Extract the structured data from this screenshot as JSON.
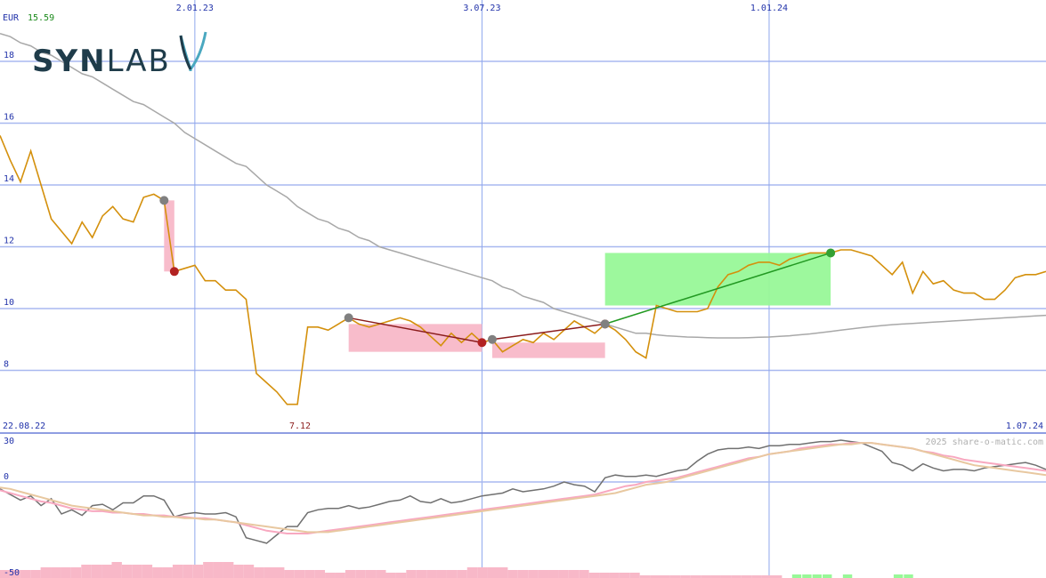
{
  "logo": {
    "bold": "SYN",
    "light": "LAB"
  },
  "header": {
    "currency": "EUR",
    "last_price": "15.59"
  },
  "watermark": "2025 share-o-matic.com",
  "colors": {
    "price": "#d4900c",
    "sma": "#a8a8a8",
    "grid": "#a8b8f0",
    "vgrid": "#8ea7ec",
    "gain_fill": "#98f898",
    "loss_fill": "#f8b8c8",
    "gain_line": "#229922",
    "loss_line": "#8b1c1c",
    "marker_grey": "#808080",
    "marker_red": "#b22222",
    "marker_green": "#33a033",
    "osc_dark": "#707070",
    "osc_pink": "#f8a8c0",
    "osc_tan": "#e8c8a0",
    "logo": "#1f3c4a",
    "logo_accent": "#4aa8c0"
  },
  "chart_data": [
    {
      "type": "line",
      "title": "",
      "x_top_labels": [
        "2.01.23",
        "3.07.23",
        "1.01.24"
      ],
      "x_bottom_labels": [
        "22.08.22",
        "7.12",
        "1.07.24"
      ],
      "y_ticks": [
        "8",
        "10",
        "12",
        "14",
        "16",
        "18"
      ],
      "ylim": [
        6,
        19
      ],
      "grid": true,
      "series": [
        {
          "key": "price",
          "values": [
            15.6,
            14.8,
            14.1,
            15.1,
            14.0,
            12.9,
            12.5,
            12.1,
            12.8,
            12.3,
            13.0,
            13.3,
            12.9,
            12.8,
            13.6,
            13.7,
            13.5,
            11.2,
            11.3,
            11.4,
            10.9,
            10.9,
            10.6,
            10.6,
            10.3,
            7.9,
            7.6,
            7.3,
            6.9,
            6.9,
            9.4,
            9.4,
            9.3,
            9.5,
            9.7,
            9.5,
            9.4,
            9.5,
            9.6,
            9.7,
            9.6,
            9.4,
            9.1,
            8.8,
            9.2,
            8.9,
            9.2,
            8.9,
            9.0,
            8.6,
            8.8,
            9.0,
            8.9,
            9.2,
            9.0,
            9.3,
            9.6,
            9.4,
            9.2,
            9.5,
            9.3,
            9.0,
            8.6,
            8.4,
            10.1,
            10.0,
            9.9,
            9.9,
            9.9,
            10.0,
            10.7,
            11.1,
            11.2,
            11.4,
            11.5,
            11.5,
            11.4,
            11.6,
            11.7,
            11.8,
            11.8,
            11.8,
            11.9,
            11.9,
            11.8,
            11.7,
            11.4,
            11.1,
            11.5,
            10.5,
            11.2,
            10.8,
            10.9,
            10.6,
            10.5,
            10.5,
            10.3,
            10.3,
            10.6,
            11.0,
            11.1,
            11.1,
            11.2
          ]
        },
        {
          "key": "sma",
          "values": [
            18.9,
            18.8,
            18.6,
            18.5,
            18.3,
            18.2,
            18.0,
            17.8,
            17.6,
            17.5,
            17.3,
            17.1,
            16.9,
            16.7,
            16.6,
            16.4,
            16.2,
            16.0,
            15.7,
            15.5,
            15.3,
            15.1,
            14.9,
            14.7,
            14.6,
            14.3,
            14.0,
            13.8,
            13.6,
            13.3,
            13.1,
            12.9,
            12.8,
            12.6,
            12.5,
            12.3,
            12.2,
            12.0,
            11.9,
            11.8,
            11.7,
            11.6,
            11.5,
            11.4,
            11.3,
            11.2,
            11.1,
            11.0,
            10.9,
            10.7,
            10.6,
            10.4,
            10.3,
            10.2,
            10.0,
            9.9,
            9.8,
            9.7,
            9.6,
            9.5,
            9.4,
            9.3,
            9.2,
            9.2,
            9.15,
            9.12,
            9.1,
            9.08,
            9.07,
            9.06,
            9.05,
            9.05,
            9.05,
            9.06,
            9.07,
            9.08,
            9.1,
            9.12,
            9.15,
            9.18,
            9.22,
            9.26,
            9.3,
            9.34,
            9.38,
            9.42,
            9.45,
            9.48,
            9.5,
            9.52,
            9.54,
            9.56,
            9.58,
            9.6,
            9.62,
            9.64,
            9.66,
            9.68,
            9.7,
            9.72,
            9.74,
            9.76,
            9.78
          ]
        }
      ],
      "annotations": [
        {
          "kind": "loss",
          "from_index": 16,
          "to_index": 17,
          "fill_top": 13.5,
          "fill_bottom": 11.2
        },
        {
          "kind": "loss",
          "from_index": 34,
          "to_index": 47,
          "fill_top": 9.5,
          "fill_bottom": 8.6
        },
        {
          "kind": "loss",
          "from_index": 48,
          "to_index": 59,
          "fill_top": 8.9,
          "fill_bottom": 8.4
        },
        {
          "kind": "gain",
          "from_index": 59,
          "to_index": 81,
          "fill_top": 11.8,
          "fill_bottom": 10.1
        }
      ]
    },
    {
      "type": "line",
      "title": "",
      "y_ticks": [
        "30",
        "0",
        "-50"
      ],
      "ylim": [
        -50,
        32
      ],
      "series": [
        {
          "key": "osc_dark",
          "values": [
            -5,
            -9,
            -13,
            -10,
            -17,
            -12,
            -23,
            -20,
            -24,
            -17,
            -16,
            -20,
            -15,
            -15,
            -10,
            -10,
            -13,
            -25,
            -23,
            -22,
            -23,
            -23,
            -22,
            -25,
            -40,
            -42,
            -44,
            -38,
            -32,
            -32,
            -22,
            -20,
            -19,
            -19,
            -17,
            -19,
            -18,
            -16,
            -14,
            -13,
            -10,
            -14,
            -15,
            -12,
            -15,
            -14,
            -12,
            -10,
            -9,
            -8,
            -5,
            -7,
            -6,
            -5,
            -3,
            0,
            -2,
            -3,
            -7,
            3,
            5,
            4,
            4,
            5,
            4,
            6,
            8,
            9,
            15,
            20,
            23,
            24,
            24,
            25,
            24,
            26,
            26,
            27,
            27,
            28,
            29,
            29,
            30,
            29,
            28,
            25,
            22,
            14,
            12,
            8,
            13,
            10,
            8,
            9,
            9,
            8,
            10,
            11,
            12,
            13,
            14,
            12,
            9
          ]
        },
        {
          "key": "osc_pink",
          "values": [
            -6,
            -8,
            -10,
            -12,
            -14,
            -15,
            -17,
            -19,
            -20,
            -21,
            -21,
            -22,
            -22,
            -23,
            -23,
            -24,
            -24,
            -25,
            -25,
            -26,
            -26,
            -27,
            -28,
            -29,
            -31,
            -33,
            -35,
            -36,
            -37,
            -37,
            -37,
            -36,
            -35,
            -34,
            -33,
            -32,
            -31,
            -30,
            -29,
            -28,
            -27,
            -26,
            -25,
            -24,
            -23,
            -22,
            -21,
            -20,
            -19,
            -18,
            -17,
            -16,
            -15,
            -14,
            -13,
            -12,
            -11,
            -10,
            -9,
            -7,
            -5,
            -3,
            -2,
            0,
            1,
            2,
            3,
            5,
            7,
            9,
            11,
            13,
            15,
            17,
            18,
            20,
            21,
            22,
            24,
            25,
            26,
            27,
            27,
            28,
            28,
            28,
            27,
            26,
            25,
            24,
            22,
            21,
            19,
            18,
            16,
            15,
            14,
            13,
            12,
            11,
            10,
            9,
            8
          ]
        },
        {
          "key": "osc_tan",
          "values": [
            -4,
            -5,
            -7,
            -9,
            -11,
            -13,
            -15,
            -17,
            -18,
            -19,
            -20,
            -21,
            -22,
            -23,
            -24,
            -24,
            -25,
            -25,
            -26,
            -26,
            -27,
            -27,
            -28,
            -29,
            -30,
            -31,
            -32,
            -33,
            -34,
            -35,
            -36,
            -36,
            -36,
            -35,
            -34,
            -33,
            -32,
            -31,
            -30,
            -29,
            -28,
            -27,
            -26,
            -25,
            -24,
            -23,
            -22,
            -21,
            -20,
            -19,
            -18,
            -17,
            -16,
            -15,
            -14,
            -13,
            -12,
            -11,
            -10,
            -9,
            -8,
            -6,
            -4,
            -2,
            -1,
            0,
            2,
            4,
            6,
            8,
            10,
            12,
            14,
            16,
            18,
            20,
            21,
            22,
            23,
            24,
            25,
            26,
            27,
            27,
            28,
            28,
            27,
            26,
            25,
            24,
            22,
            20,
            18,
            16,
            14,
            12,
            11,
            10,
            9,
            8,
            7,
            6,
            5
          ]
        }
      ],
      "volume_bars": [
        3,
        3,
        3,
        3,
        4,
        4,
        4,
        4,
        5,
        5,
        5,
        6,
        5,
        5,
        5,
        4,
        4,
        5,
        5,
        5,
        6,
        6,
        6,
        5,
        5,
        4,
        4,
        4,
        3,
        3,
        3,
        3,
        2,
        2,
        3,
        3,
        3,
        3,
        2,
        2,
        3,
        3,
        3,
        3,
        3,
        3,
        4,
        4,
        4,
        4,
        3,
        3,
        3,
        3,
        3,
        3,
        3,
        3,
        2,
        2,
        2,
        2,
        2,
        1,
        1,
        1,
        1,
        1,
        1,
        1,
        1,
        1,
        1,
        1,
        1,
        1,
        1,
        0,
        0,
        0,
        0,
        0,
        0,
        0,
        0,
        0,
        0,
        0,
        0,
        0,
        0,
        0,
        0,
        0,
        0,
        0,
        0,
        0,
        0,
        0,
        0,
        0,
        0
      ],
      "volume_signal": [
        0,
        0,
        0,
        0,
        0,
        0,
        0,
        0,
        0,
        0,
        0,
        0,
        0,
        0,
        0,
        0,
        0,
        0,
        0,
        0,
        0,
        0,
        0,
        0,
        0,
        0,
        0,
        0,
        0,
        0,
        0,
        0,
        0,
        0,
        0,
        0,
        0,
        0,
        0,
        0,
        0,
        0,
        0,
        0,
        0,
        0,
        0,
        0,
        0,
        0,
        0,
        0,
        0,
        0,
        0,
        0,
        0,
        0,
        0,
        0,
        0,
        0,
        0,
        0,
        0,
        0,
        0,
        0,
        0,
        0,
        0,
        0,
        0,
        0,
        0,
        0,
        0,
        0,
        1,
        1,
        1,
        1,
        0,
        1,
        0,
        0,
        0,
        0,
        1,
        1,
        0,
        0,
        0,
        0,
        0,
        0,
        0,
        0,
        0,
        0,
        0,
        0,
        0
      ]
    }
  ]
}
